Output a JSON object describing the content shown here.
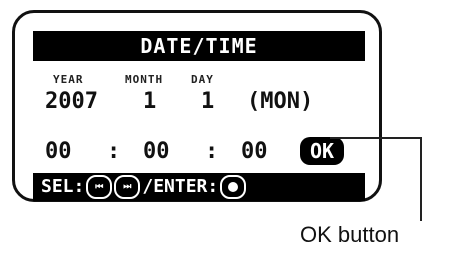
{
  "screen": {
    "title": "DATE/TIME",
    "labels": {
      "year": "YEAR",
      "month": "MONTH",
      "day": "DAY"
    },
    "values": {
      "year": "2007",
      "month": "1",
      "day": "1",
      "weekday": "(MON)"
    },
    "time": {
      "hours": "00",
      "sep1": ":",
      "minutes": "00",
      "sep2": ":",
      "seconds": "00"
    },
    "ok": "OK",
    "footer": {
      "sel": "SEL:",
      "enter": "/ENTER:"
    },
    "keys": {
      "prev": "⏮",
      "next": "⏭"
    }
  },
  "callout": {
    "label": "OK button"
  },
  "icons": [
    "prev-track-icon",
    "next-track-icon",
    "enter-dot-icon"
  ]
}
